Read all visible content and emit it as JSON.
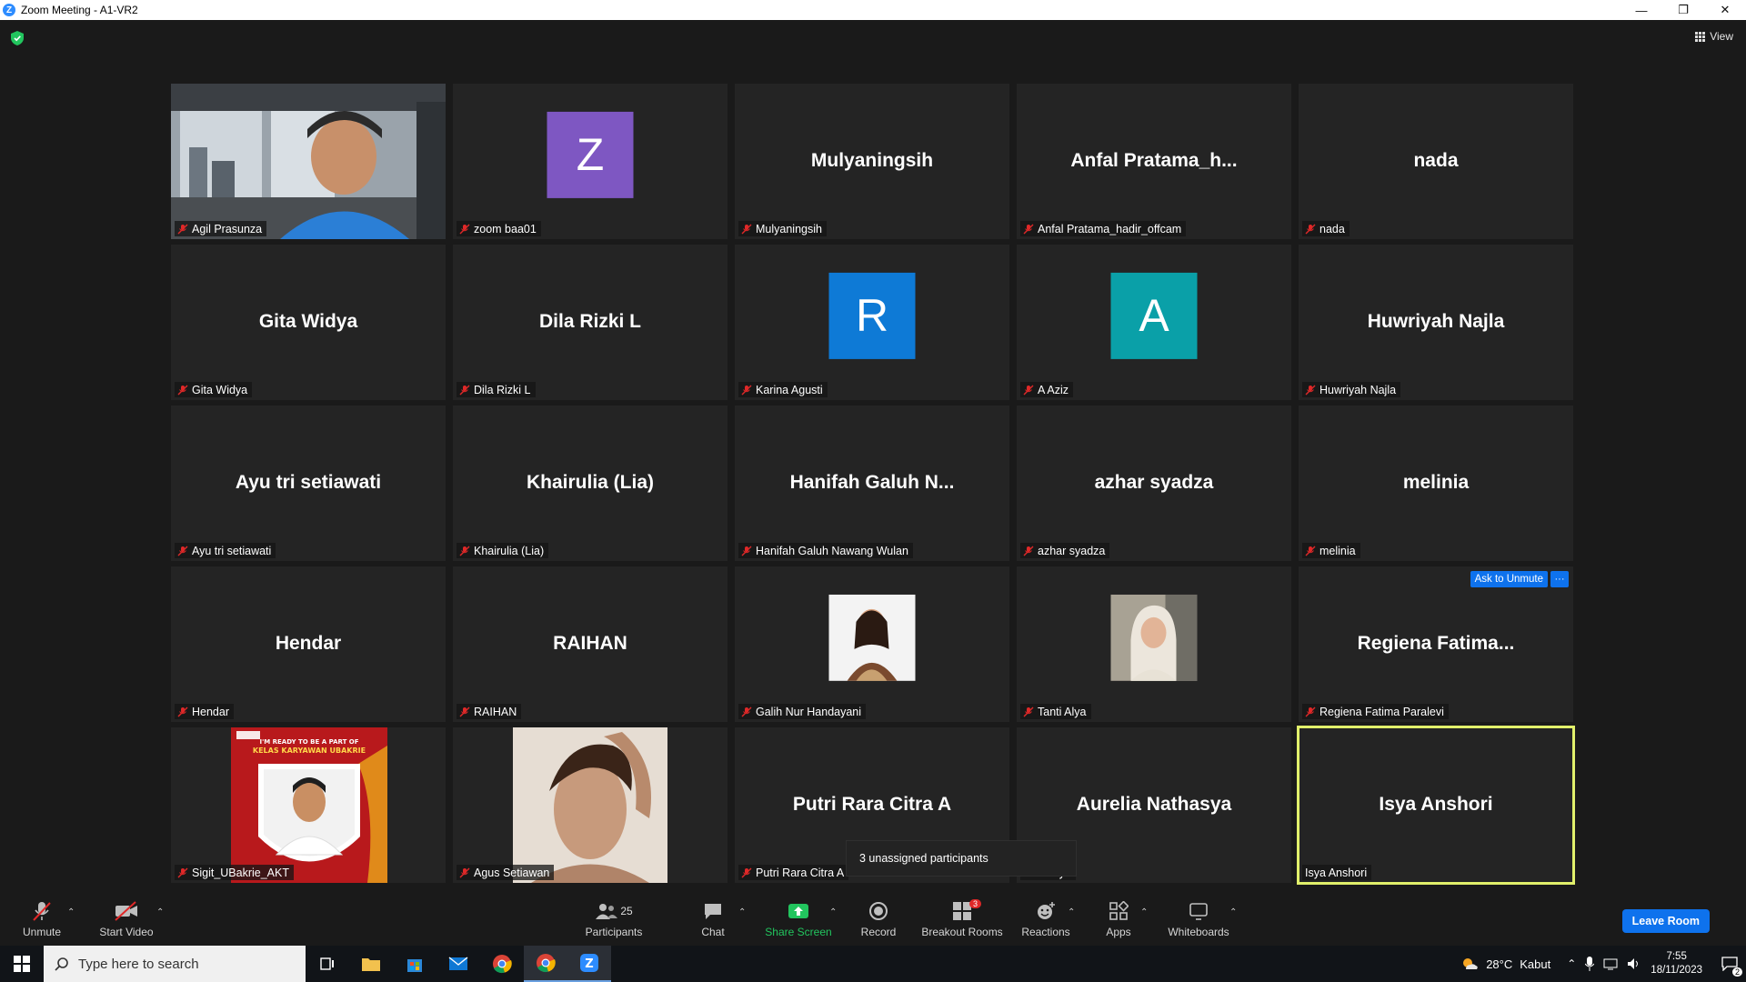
{
  "window": {
    "title": "Zoom Meeting - A1-VR2",
    "app_icon": "zoom-logo-icon",
    "view_label": "View"
  },
  "tiles": [
    {
      "name": "Agil Prasunza",
      "display": "",
      "type": "photo"
    },
    {
      "name": "zoom baa01",
      "display": "Z",
      "type": "avatar",
      "color": "#7e57c2"
    },
    {
      "name": "Mulyaningsih",
      "display": "Mulyaningsih",
      "type": "name"
    },
    {
      "name": "Anfal Pratama_hadir_offcam",
      "display": "Anfal  Pratama_h...",
      "type": "name"
    },
    {
      "name": "nada",
      "display": "nada",
      "type": "name"
    },
    {
      "name": "Gita Widya",
      "display": "Gita Widya",
      "type": "name"
    },
    {
      "name": "Dila Rizki L",
      "display": "Dila Rizki L",
      "type": "name"
    },
    {
      "name": "Karina Agusti",
      "display": "R",
      "type": "avatar",
      "color": "#0e7ad6"
    },
    {
      "name": "A Aziz",
      "display": "A",
      "type": "avatar",
      "color": "#0aa0a8"
    },
    {
      "name": "Huwriyah Najla",
      "display": "Huwriyah Najla",
      "type": "name"
    },
    {
      "name": "Ayu tri setiawati",
      "display": "Ayu tri setiawati",
      "type": "name"
    },
    {
      "name": "Khairulia (Lia)",
      "display": "Khairulia (Lia)",
      "type": "name"
    },
    {
      "name": "Hanifah Galuh Nawang Wulan",
      "display": "Hanifah  Galuh  N...",
      "type": "name"
    },
    {
      "name": "azhar syadza",
      "display": "azhar syadza",
      "type": "name"
    },
    {
      "name": "melinia",
      "display": "melinia",
      "type": "name"
    },
    {
      "name": "Hendar",
      "display": "Hendar",
      "type": "name"
    },
    {
      "name": "RAIHAN",
      "display": "RAIHAN",
      "type": "name"
    },
    {
      "name": "Galih Nur Handayani",
      "display": "",
      "type": "profile"
    },
    {
      "name": "Tanti Alya",
      "display": "",
      "type": "profile"
    },
    {
      "name": "Regiena Fatima Paralevi",
      "display": "Regiena  Fatima...",
      "type": "name"
    },
    {
      "name": "Sigit_UBakrie_AKT",
      "display": "",
      "type": "photo"
    },
    {
      "name": "Agus Setiawan",
      "display": "",
      "type": "photo"
    },
    {
      "name": "Putri Rara Citra A",
      "display": "Putri Rara Citra A",
      "type": "name"
    },
    {
      "name": "Nathasya",
      "display": "Aurelia Nathasya",
      "type": "name"
    },
    {
      "name": "Isya Anshori",
      "display": "Isya Anshori",
      "type": "name",
      "active": true,
      "unmuted": true
    }
  ],
  "poster_text": {
    "line1": "I'M READY TO BE A PART OF",
    "line2": "KELAS KARYAWAN UBAKRIE"
  },
  "hover": {
    "ask_unmute": "Ask to Unmute",
    "more": "···"
  },
  "tooltip": "3 unassigned participants",
  "toolbar": {
    "unmute": "Unmute",
    "start_video": "Start Video",
    "participants": "Participants",
    "participants_count": "25",
    "chat": "Chat",
    "share_screen": "Share Screen",
    "record": "Record",
    "breakout_rooms": "Breakout Rooms",
    "breakout_badge": "3",
    "reactions": "Reactions",
    "apps": "Apps",
    "whiteboards": "Whiteboards",
    "leave": "Leave Room"
  },
  "taskbar": {
    "search_placeholder": "Type here to search",
    "weather_temp": "28°C",
    "weather_text": "Kabut",
    "time": "7:55",
    "date": "18/11/2023",
    "notifications": "2"
  },
  "colors": {
    "accent": "#0e72ed",
    "share_green": "#22c55e",
    "active_border": "#e1f06b",
    "mute_red": "#e02828"
  }
}
